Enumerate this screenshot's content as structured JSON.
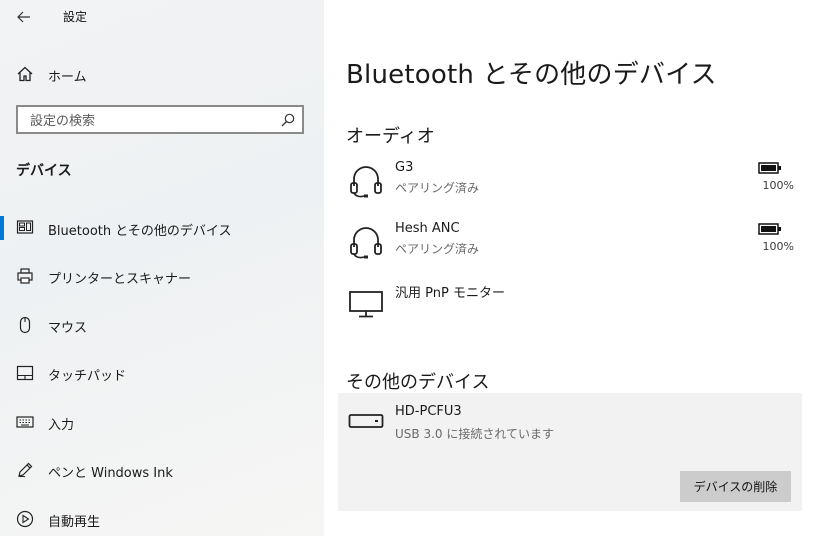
{
  "window": {
    "title": "設定"
  },
  "sidebar": {
    "home_label": "ホーム",
    "search_placeholder": "設定の検索",
    "section_title": "デバイス",
    "items": [
      {
        "label": "Bluetooth とその他のデバイス",
        "icon": "bluetooth-devices-icon",
        "selected": true
      },
      {
        "label": "プリンターとスキャナー",
        "icon": "printer-icon",
        "selected": false
      },
      {
        "label": "マウス",
        "icon": "mouse-icon",
        "selected": false
      },
      {
        "label": "タッチパッド",
        "icon": "touchpad-icon",
        "selected": false
      },
      {
        "label": "入力",
        "icon": "keyboard-icon",
        "selected": false
      },
      {
        "label": "ペンと Windows Ink",
        "icon": "pen-icon",
        "selected": false
      },
      {
        "label": "自動再生",
        "icon": "autoplay-icon",
        "selected": false
      }
    ]
  },
  "main": {
    "title": "Bluetooth とその他のデバイス",
    "audio_section": {
      "title": "オーディオ",
      "devices": [
        {
          "name": "G3",
          "status": "ペアリング済み",
          "battery": "100%",
          "icon": "headset-icon"
        },
        {
          "name": "Hesh ANC",
          "status": "ペアリング済み",
          "battery": "100%",
          "icon": "headset-icon"
        },
        {
          "name": "汎用 PnP モニター",
          "status": "",
          "battery": "",
          "icon": "monitor-icon"
        }
      ]
    },
    "other_section": {
      "title": "その他のデバイス",
      "device": {
        "name": "HD-PCFU3",
        "status": "USB 3.0 に接続されています",
        "icon": "usb-drive-icon"
      },
      "remove_button_label": "デバイスの削除"
    }
  },
  "colors": {
    "accent": "#0078d7",
    "button_bg": "#cccccc",
    "panel_bg": "#f2f2f2"
  }
}
